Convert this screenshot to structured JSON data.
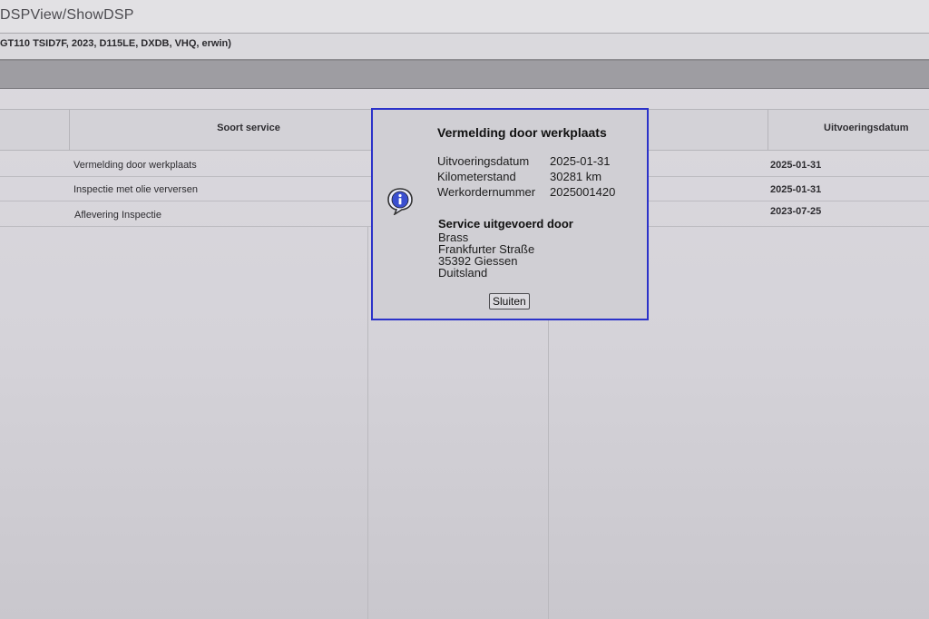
{
  "browser": {
    "url": "DSPView/ShowDSP"
  },
  "vehicle": {
    "info": "GT110 TSID7F, 2023, D115LE, DXDB, VHQ, erwin)"
  },
  "table": {
    "headers": {
      "soort_service": "Soort service",
      "uitvoeringsdatum": "Uitvoeringsdatum"
    },
    "rows": [
      {
        "service": "Vermelding door werkplaats",
        "date": "2025-01-31"
      },
      {
        "service": "Inspectie met olie verversen",
        "date": "2025-01-31"
      },
      {
        "service": "Aflevering Inspectie",
        "date": "2023-07-25"
      }
    ]
  },
  "dialog": {
    "title": "Vermelding door werkplaats",
    "icon": "info-icon",
    "fields": [
      {
        "label": "Uitvoeringsdatum",
        "value": "2025-01-31"
      },
      {
        "label": "Kilometerstand",
        "value": "30281 km"
      },
      {
        "label": "Werkordernummer",
        "value": "2025001420"
      }
    ],
    "service_heading": "Service uitgevoerd door",
    "address": [
      "Brass",
      "Frankfurter Straße",
      "35392 Giessen",
      "Duitsland"
    ],
    "close_label": "Sluiten",
    "border_color": "#2b32c9"
  }
}
